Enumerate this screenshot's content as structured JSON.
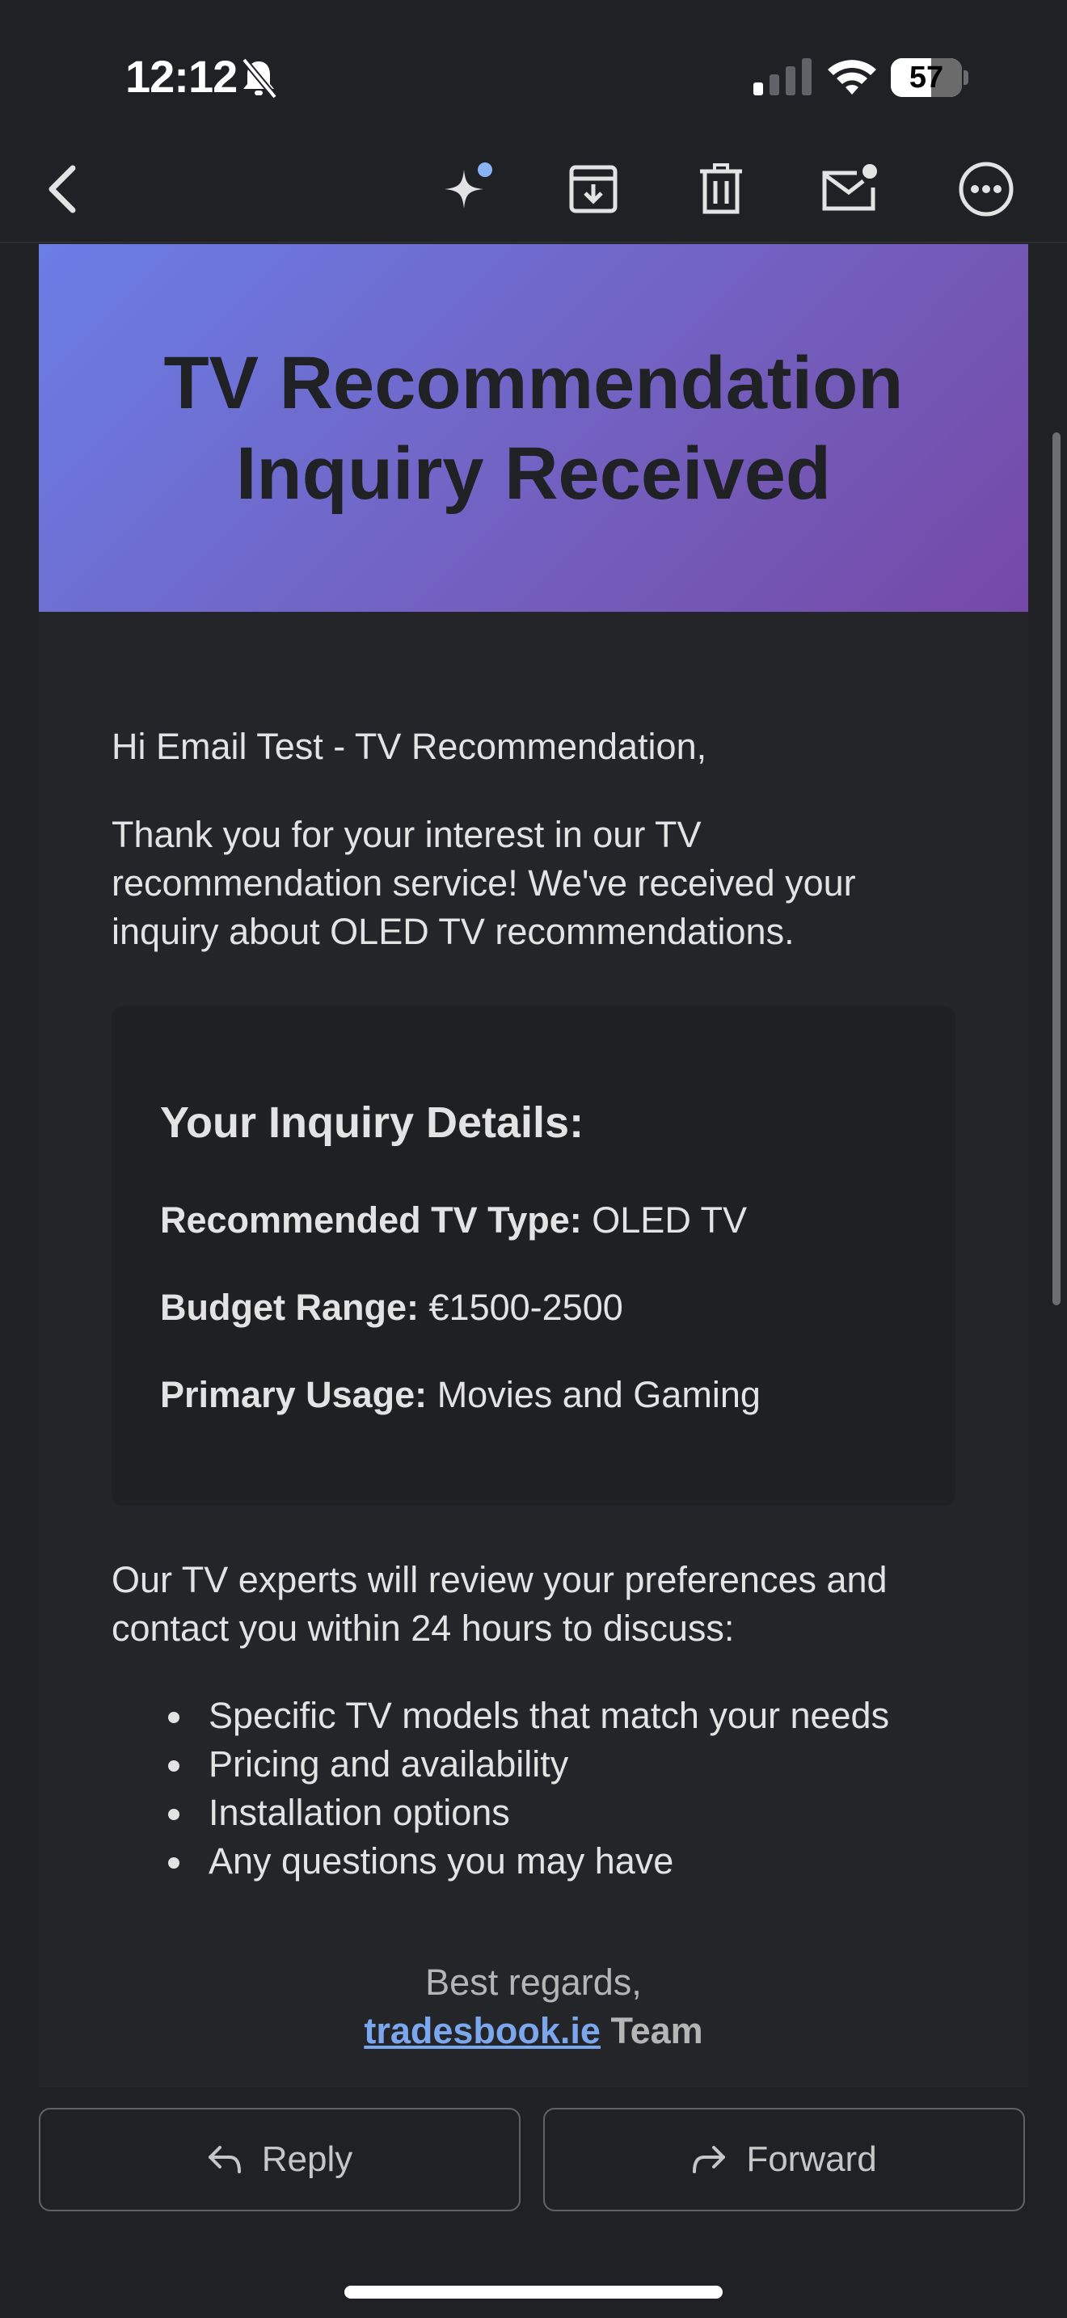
{
  "status_bar": {
    "time": "12:12",
    "battery_level": "57",
    "battery_fraction": 0.57,
    "icons": [
      "bell-slash-icon",
      "cellular-signal-icon",
      "wifi-icon",
      "battery-icon"
    ]
  },
  "toolbar": {
    "icons": [
      "back-arrow-icon",
      "sparkle-icon",
      "archive-icon",
      "trash-icon",
      "mark-unread-icon",
      "more-icon"
    ],
    "accent_color": "#8ab4f8"
  },
  "email": {
    "banner_title": "TV Recommendation Inquiry Received",
    "greeting": "Hi Email Test - TV Recommendation,",
    "intro": "Thank you for your interest in our TV recommendation service! We've received your inquiry about OLED TV recommendations.",
    "details": {
      "title": "Your Inquiry Details:",
      "items": [
        {
          "label": "Recommended TV Type:",
          "value": "OLED TV"
        },
        {
          "label": "Budget Range:",
          "value": "€1500-2500"
        },
        {
          "label": "Primary Usage:",
          "value": "Movies and Gaming"
        }
      ]
    },
    "followup": "Our TV experts will review your preferences and contact you within 24 hours to discuss:",
    "bullets": [
      "Specific TV models that match your needs",
      "Pricing and availability",
      "Installation options",
      "Any questions you may have"
    ],
    "signoff": "Best regards,",
    "signature_link": "tradesbook.ie",
    "signature_team": "Team"
  },
  "actions": {
    "reply_label": "Reply",
    "forward_label": "Forward"
  }
}
